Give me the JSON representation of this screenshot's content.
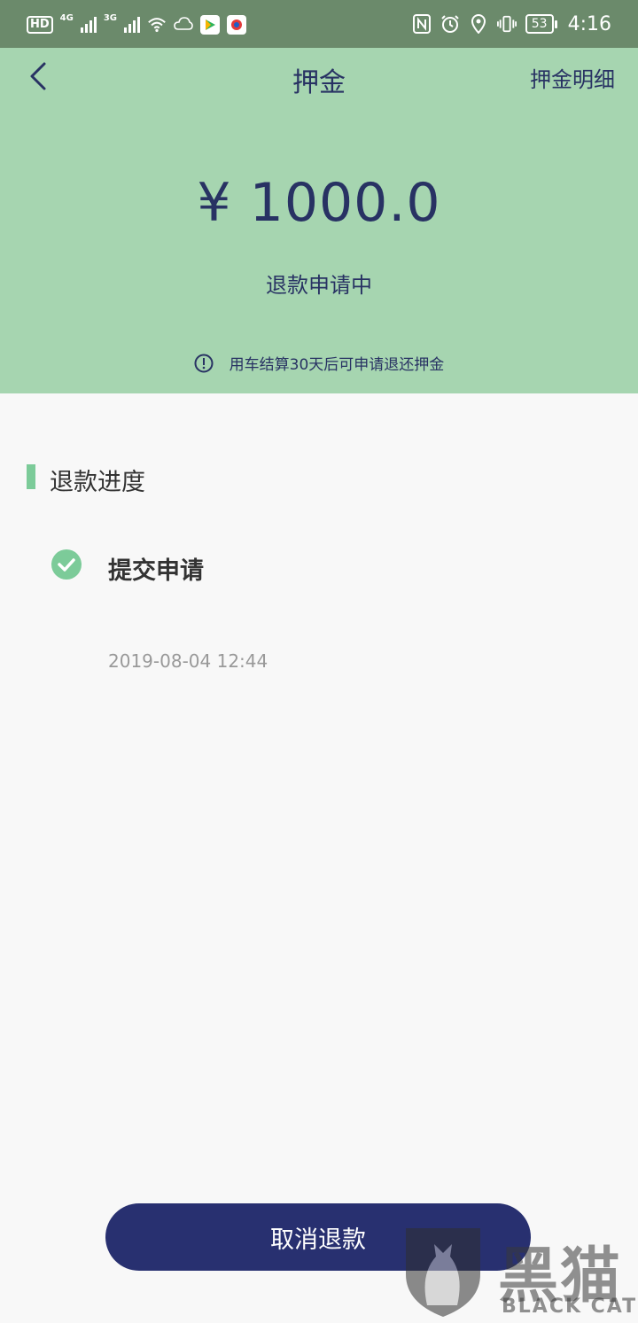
{
  "status_bar": {
    "hd_label": "HD",
    "net1": "4G",
    "net2": "3G",
    "battery": "53",
    "time": "4:16"
  },
  "header": {
    "title": "押金",
    "detail_link": "押金明细",
    "amount": "¥ 1000.0",
    "refund_status": "退款申请中",
    "notice": "用车结算30天后可申请退还押金"
  },
  "progress": {
    "section_title": "退款进度",
    "steps": [
      {
        "title": "提交申请",
        "time": "2019-08-04 12:44",
        "done": true
      }
    ]
  },
  "actions": {
    "cancel_label": "取消退款"
  },
  "watermark": {
    "cn": "黑猫",
    "en": "BLACK CAT"
  },
  "colors": {
    "header_bg": "#a6d5b0",
    "primary": "#283070",
    "accent_green": "#7ccb99"
  }
}
